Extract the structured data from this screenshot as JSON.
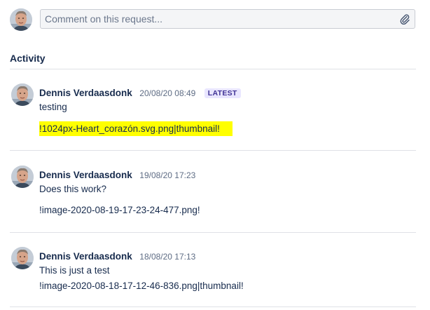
{
  "composer": {
    "placeholder": "Comment on this request...",
    "attach_icon": "paperclip-icon"
  },
  "activity": {
    "title": "Activity",
    "entries": [
      {
        "author": "Dennis Verdaasdonk",
        "time": "20/08/20 08:49",
        "badge": "LATEST",
        "lines": [
          "testing",
          "!1024px-Heart_corazón.svg.png|thumbnail!"
        ],
        "highlight_color": "#ffff00"
      },
      {
        "author": "Dennis Verdaasdonk",
        "time": "19/08/20 17:23",
        "lines": [
          "Does this work?",
          "!image-2020-08-19-17-23-24-477.png!"
        ]
      },
      {
        "author": "Dennis Verdaasdonk",
        "time": "18/08/20 17:13",
        "lines": [
          "This is just a test",
          "!image-2020-08-18-17-12-46-836.png|thumbnail!"
        ]
      }
    ]
  },
  "colors": {
    "badge_bg": "#e9e6ff",
    "badge_text": "#403294",
    "text": "#172b4d",
    "muted": "#5e6c84",
    "divider": "#dfe1e6"
  }
}
